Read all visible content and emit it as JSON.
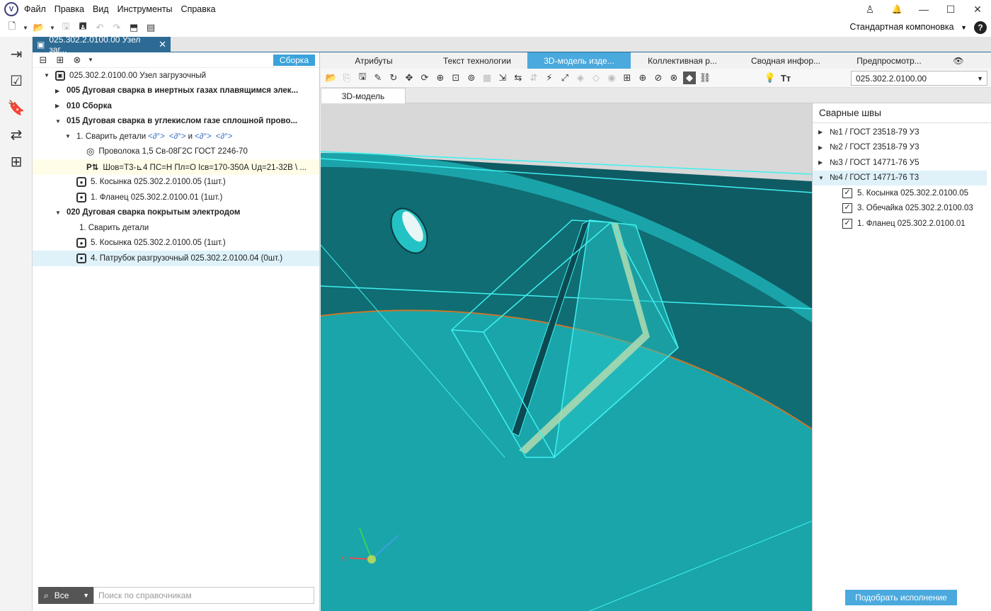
{
  "menu": [
    "Файл",
    "Правка",
    "Вид",
    "Инструменты",
    "Справка"
  ],
  "window_controls": {
    "user": "♙",
    "bell": "🔔",
    "minimize": "—",
    "maximize": "☐",
    "close": "✕"
  },
  "layout_selector": "Стандартная компоновка",
  "document_tab": {
    "title": "025.302.2.0100.00 Узел заг...",
    "close": "✕"
  },
  "left_panel": {
    "badge": "Сборка",
    "search": {
      "filter": "Все",
      "placeholder": "Поиск по справочникам"
    },
    "tree": [
      {
        "text": "025.302.2.0100.00 Узел загрузочный"
      },
      {
        "text": "005 Дуговая сварка в инертных газах плавящимся элек..."
      },
      {
        "text": "010 Сборка"
      },
      {
        "text": "015 Дуговая сварка в углекислом газе сплошной прово..."
      },
      {
        "text": "1. Сварить детали",
        "links": [
          "<∂°>",
          "<∂°>"
        ],
        "and": "и",
        "links2": [
          "<∂°>",
          "<∂°>"
        ]
      },
      {
        "text": "Проволока 1,5 Св-08Г2С ГОСТ 2246-70"
      },
      {
        "text": "Шов=Т3-⊾4 ПС=Н Пл=О Iсв=170-350А Uд=21-32В \\ ..."
      },
      {
        "text": "5. Косынка 025.302.2.0100.05 (1шт.)"
      },
      {
        "text": "1. Фланец 025.302.2.0100.01 (1шт.)"
      },
      {
        "text": "020 Дуговая сварка покрытым электродом"
      },
      {
        "text": "1. Сварить детали"
      },
      {
        "text": "5. Косынка 025.302.2.0100.05 (1шт.)"
      },
      {
        "text": "4. Патрубок разгрузочный 025.302.2.0100.04 (0шт.)"
      }
    ]
  },
  "right_tabs": [
    "Атрибуты",
    "Текст технологии",
    "3D-модель изде...",
    "Коллективная р...",
    "Сводная инфор...",
    "Предпросмотр..."
  ],
  "model_combo": "025.302.2.0100.00",
  "view_tab": "3D-модель",
  "weld_panel": {
    "title": "Сварные швы",
    "welds": [
      "№1 / ГОСТ 23518-79 У3",
      "№2 / ГОСТ 23518-79 У3",
      "№3 / ГОСТ 14771-76 У5",
      "№4 / ГОСТ 14771-76 Т3"
    ],
    "parts": [
      "5. Косынка 025.302.2.0100.05",
      "3. Обечайка 025.302.2.0100.03",
      "1. Фланец 025.302.2.0100.01"
    ],
    "button": "Подобрать исполнение"
  },
  "colors": {
    "accent": "#4aa9dd",
    "doc_tab": "#2d6b94",
    "model": "#17a3a8",
    "highlight": "#3ff0f0"
  },
  "axis_labels": {
    "x": "X"
  }
}
